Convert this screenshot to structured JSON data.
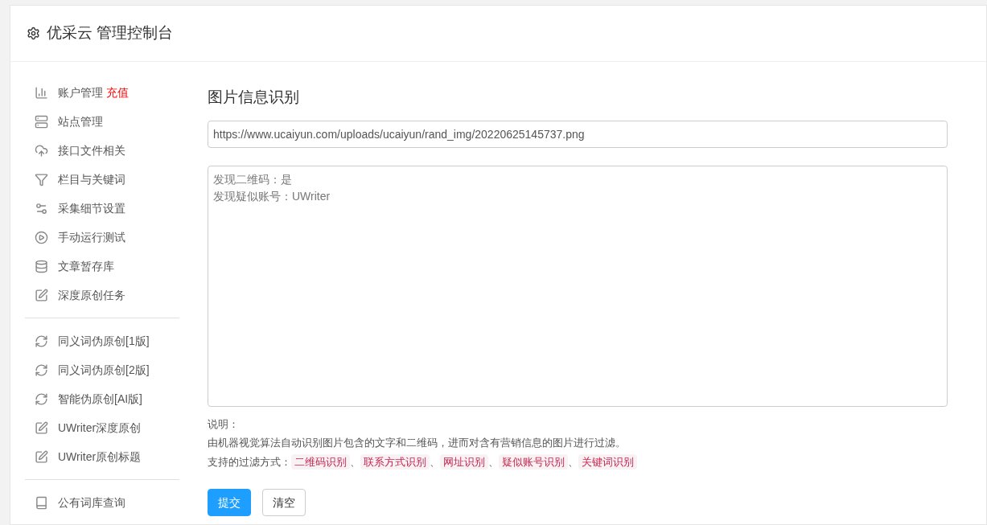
{
  "header": {
    "title": "优采云 管理控制台"
  },
  "sidebar": {
    "groups": [
      {
        "items": [
          {
            "label": "账户管理",
            "badge": "充值"
          },
          {
            "label": "站点管理"
          },
          {
            "label": "接口文件相关"
          },
          {
            "label": "栏目与关键词"
          },
          {
            "label": "采集细节设置"
          },
          {
            "label": "手动运行测试"
          },
          {
            "label": "文章暂存库"
          },
          {
            "label": "深度原创任务"
          }
        ]
      },
      {
        "items": [
          {
            "label": "同义词伪原创[1版]"
          },
          {
            "label": "同义词伪原创[2版]"
          },
          {
            "label": "智能伪原创[AI版]"
          },
          {
            "label": "UWriter深度原创"
          },
          {
            "label": "UWriter原创标题"
          }
        ]
      },
      {
        "items": [
          {
            "label": "公有词库查询"
          }
        ]
      }
    ]
  },
  "main": {
    "title": "图片信息识别",
    "url_field": {
      "value": "https://www.ucaiyun.com/uploads/ucaiyun/rand_img/20220625145737.png"
    },
    "result_box": {
      "lines": [
        "发现二维码：是",
        "发现疑似账号：UWriter"
      ]
    },
    "note_label": "说明：",
    "description": "由机器视觉算法自动识别图片包含的文字和二维码，进而对含有营销信息的图片进行过滤。",
    "filters_label": "支持的过滤方式：",
    "filters": [
      "二维码识别",
      "联系方式识别",
      "网址识别",
      "疑似账号识别",
      "关键词识别"
    ],
    "separator": "、",
    "buttons": [
      {
        "label": "提交",
        "kind": "primary"
      },
      {
        "label": "清空",
        "kind": "default"
      }
    ]
  }
}
